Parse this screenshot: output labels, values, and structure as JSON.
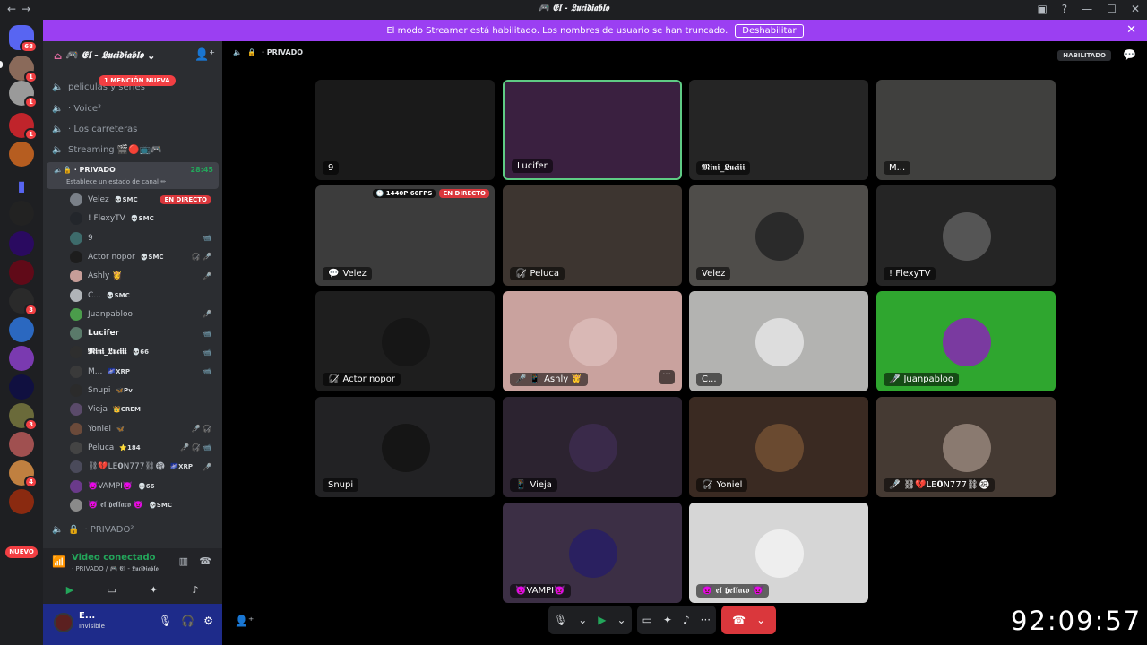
{
  "titlebar": {
    "back": "←",
    "forward": "→",
    "title": "🎮 𝕰𝖑 - 𝕷𝖚𝖈𝖎𝖉𝖎𝖆𝖇𝖑𝖔",
    "icons": [
      "inbox-icon",
      "help-icon",
      "minimize-icon",
      "maximize-icon",
      "close-icon"
    ]
  },
  "servers": {
    "home_badge": "68",
    "badges": [
      "1",
      "1",
      "1",
      "3",
      "3",
      "4"
    ],
    "new_label": "NUEVO"
  },
  "banner": {
    "text": "El modo Streamer está habilitado. Los nombres de usuario se han truncado.",
    "button": "Deshabilitar",
    "close": "✕"
  },
  "guild": {
    "name": "🎮 𝕰𝖑 - 𝕷𝖚𝖈𝖎𝖉𝖎𝖆𝖇𝖑𝖔"
  },
  "channels": [
    {
      "name": "peliculas y series"
    },
    {
      "name": "· Voice³"
    },
    {
      "name": "· Los carreteras"
    },
    {
      "name": "Streaming 🎬🔴📺🎮"
    }
  ],
  "mention": "1 MENCIÓN NUEVA",
  "active_channel": {
    "name": "· PRIVADO",
    "time": "28:45",
    "status": "Establece un estado de canal ✏"
  },
  "members": [
    {
      "name": "Velez",
      "badge": "💀SMC",
      "right": "EN DIRECTO",
      "live": true,
      "color": "#7a8088"
    },
    {
      "name": "! FlexyTV",
      "badge": "💀SMC",
      "right": "",
      "color": "#23262b"
    },
    {
      "name": "9",
      "badge": "",
      "right": "📹",
      "color": "#3d6b6b"
    },
    {
      "name": "Actor nopor",
      "badge": "💀SMC",
      "right": "🎧̸ 🎤̸",
      "color": "#1d1d1d"
    },
    {
      "name": "Ashly 👸",
      "badge": "",
      "right": "🎤",
      "color": "#c79d98"
    },
    {
      "name": "C...",
      "badge": "💀SMC",
      "right": "",
      "color": "#b0b4b8"
    },
    {
      "name": "Juanpabloo",
      "badge": "",
      "right": "🎤̸",
      "color": "#4b9c4b"
    },
    {
      "name": "Lucifer",
      "badge": "",
      "right": "📹",
      "color": "#5a7a6a",
      "hl": true
    },
    {
      "name": "𝕸𝖎𝖓𝖎_𝕷𝖚𝖈𝖎𝖎𝖎",
      "badge": "💀66",
      "right": "📹",
      "color": "#2e2e2e",
      "hl": true
    },
    {
      "name": "M...",
      "badge": "🌌XRP",
      "right": "📹",
      "color": "#3a3a3a"
    },
    {
      "name": "Snupi",
      "badge": "🦋Pv",
      "right": "",
      "color": "#2b2b2b"
    },
    {
      "name": "Vieja",
      "badge": "👑CREM",
      "right": "",
      "color": "#5a4a6a"
    },
    {
      "name": "Yoniel",
      "badge": "🦋",
      "right": "🎤̸ 🎧̸",
      "color": "#6b4a3a"
    },
    {
      "name": "Peluca",
      "badge": "⭐184",
      "right": "🎤̸ 🎧̸ 📹",
      "color": "#444"
    },
    {
      "name": "⛓💔LE𝟬N777⛓㊗",
      "badge": "🌌XRP",
      "right": "🎤̸",
      "color": "#4a4a5a"
    },
    {
      "name": "👿VAMPI👿",
      "badge": "💀66",
      "right": "",
      "color": "#6a3a8a"
    },
    {
      "name": "👿 𝖊𝖑 𝖇𝖊𝖑𝖑𝖆𝖈𝖔 👿",
      "badge": "💀SMC",
      "right": "",
      "color": "#8a8a8a"
    }
  ],
  "next_channel": {
    "name": "· PRIVADO²"
  },
  "voice": {
    "status": "Video conectado",
    "sub": "· PRIVADO / 🎮 𝕰𝖑 - 𝕷𝖚𝖈𝖎𝖉𝖎𝖆𝖇𝖑𝖔"
  },
  "user": {
    "name": "E...",
    "status": "Invisible"
  },
  "stage": {
    "channel": "· PRIVADO",
    "habilitado": "HABILITADO"
  },
  "tiles": [
    {
      "label": "9",
      "bg": "#1a1a1a",
      "circle": "",
      "icons": ""
    },
    {
      "label": "Lucifer",
      "bg": "#3a2040",
      "circle": "",
      "icons": "",
      "border": "#5ecb84"
    },
    {
      "label": "𝕸𝖎𝖓𝖎_𝕷𝖚𝖈𝖎𝖎𝖎",
      "bg": "#252525",
      "circle": "",
      "icons": ""
    },
    {
      "label": "M...",
      "bg": "#40403e",
      "circle": "",
      "icons": ""
    },
    {
      "label": "Velez",
      "bg": "#3c3c3c",
      "circle": "",
      "icons": "💬",
      "tags": [
        "🕑 1440P 60FPS",
        "EN DIRECTO"
      ]
    },
    {
      "label": "Peluca",
      "bg": "#3d3530",
      "circle": "",
      "icons": "🎧̸"
    },
    {
      "label": "Velez",
      "bg": "#4f4d4a",
      "circle": "#2a2a2a",
      "icons": ""
    },
    {
      "label": "! FlexyTV",
      "bg": "#252525",
      "circle": "#555",
      "icons": ""
    },
    {
      "label": "Actor nopor",
      "bg": "#1e1e1e",
      "circle": "#161616",
      "icons": "🎧̸"
    },
    {
      "label": "Ashly 👸",
      "bg": "#c9a29e",
      "circle": "#d9b8b5",
      "icons": "🎤 📱",
      "more": "···"
    },
    {
      "label": "C...",
      "bg": "#b3b3b1",
      "circle": "#dddddd",
      "icons": ""
    },
    {
      "label": "Juanpabloo",
      "bg": "#2fa62f",
      "circle": "#7a3aa0",
      "icons": "🎤̸"
    },
    {
      "label": "Snupi",
      "bg": "#222224",
      "circle": "#151515",
      "icons": ""
    },
    {
      "label": "Vieja",
      "bg": "#2c2330",
      "circle": "#3a2a4a",
      "icons": "📱"
    },
    {
      "label": "Yoniel",
      "bg": "#3a2a22",
      "circle": "#6a4a30",
      "icons": "🎧̸"
    },
    {
      "label": "⛓💔LE𝟬N777⛓㊗",
      "bg": "#453a33",
      "circle": "#8a7a70",
      "icons": "🎤̸"
    },
    {
      "label": "👿VAMPI👿",
      "bg": "#3c2f45",
      "circle": "#2a2060",
      "icons": ""
    },
    {
      "label": "👿 𝖊𝖑 𝖇𝖊𝖑𝖑𝖆𝖈𝖔 👿",
      "bg": "#d6d6d6",
      "circle": "#eeeeee",
      "icons": ""
    }
  ],
  "clock": "92:09:57"
}
